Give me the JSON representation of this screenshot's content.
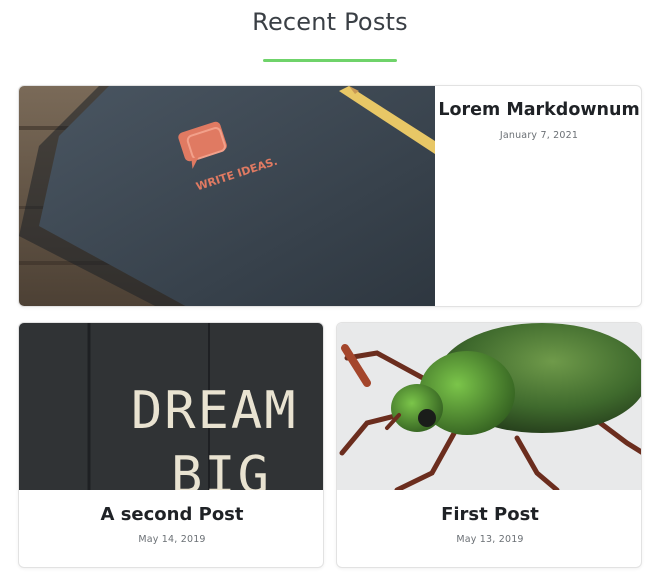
{
  "section": {
    "title": "Recent Posts",
    "accent_color": "#6fd36a"
  },
  "posts": [
    {
      "title": "Lorem Markdownum",
      "date": "January 7, 2021",
      "image_text": "WRITE IDEAS."
    },
    {
      "title": "A second Post",
      "date": "May 14, 2019",
      "image_text": [
        "DREAM",
        "BIG"
      ]
    },
    {
      "title": "First Post",
      "date": "May 13, 2019"
    }
  ]
}
